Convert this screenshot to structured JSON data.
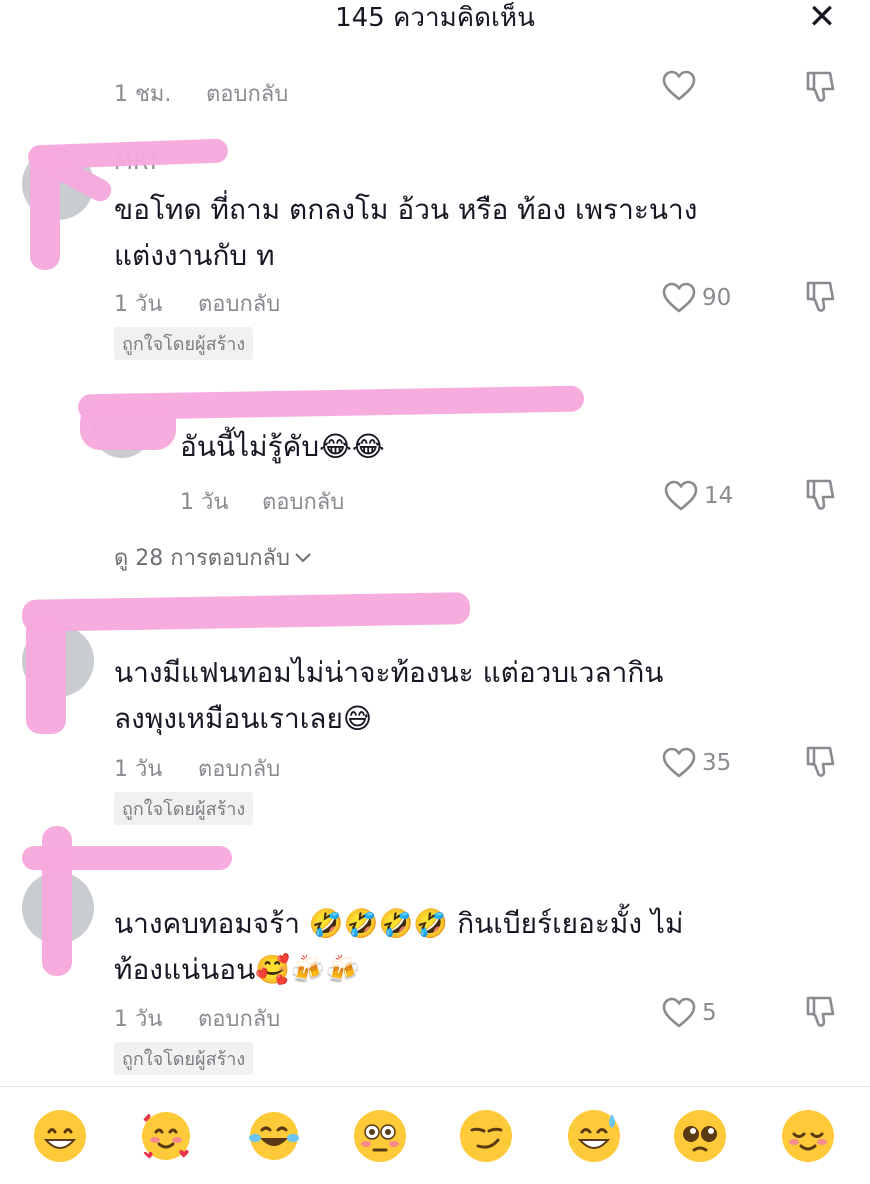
{
  "header": {
    "title": "145 ความคิดเห็น",
    "close_glyph": "✕"
  },
  "comments": [
    {
      "time": "1 ชม.",
      "reply": "ตอบกลับ",
      "likes": ""
    },
    {
      "username": "MRT",
      "text_line1": "ขอโทด ที่ถาม ตกลงโม อ้วน หรือ ท้อง เพราะนาง",
      "text_line2": "แต่งงานกับ ท",
      "time": "1 วัน",
      "reply": "ตอบกลับ",
      "likes": "90",
      "badge": "ถูกใจโดยผู้สร้าง"
    },
    {
      "text_line1": "อันนี้ไม่รู้คับ😂😂",
      "time": "1 วัน",
      "reply": "ตอบกลับ",
      "likes": "14"
    },
    {
      "text_line1": "นางมีแฟนทอมไม่น่าจะท้องนะ แต่อวบเวลากิน",
      "text_line2": "ลงพุงเหมือนเราเลย😅",
      "time": "1 วัน",
      "reply": "ตอบกลับ",
      "likes": "35",
      "badge": "ถูกใจโดยผู้สร้าง"
    },
    {
      "text_line1": "นางคบทอมจร้า 🤣🤣🤣🤣 กินเบียร์เยอะมั้ง ไม่",
      "text_line2": "ท้องแน่นอน🥰🍻🍻",
      "time": "1 วัน",
      "reply": "ตอบกลับ",
      "likes": "5",
      "badge": "ถูกใจโดยผู้สร้าง"
    }
  ],
  "view_more": {
    "label": "ดู 28 การตอบกลับ"
  },
  "emoji_bar": [
    "grin",
    "smiling-face-with-hearts",
    "tears-of-joy",
    "flushed",
    "smirk",
    "sweat-smile",
    "pleading",
    "relieved"
  ],
  "colors": {
    "redaction": "#f6a9dc",
    "text": "#161823",
    "muted": "#8a8b91",
    "emoji": "#ffca3a"
  }
}
